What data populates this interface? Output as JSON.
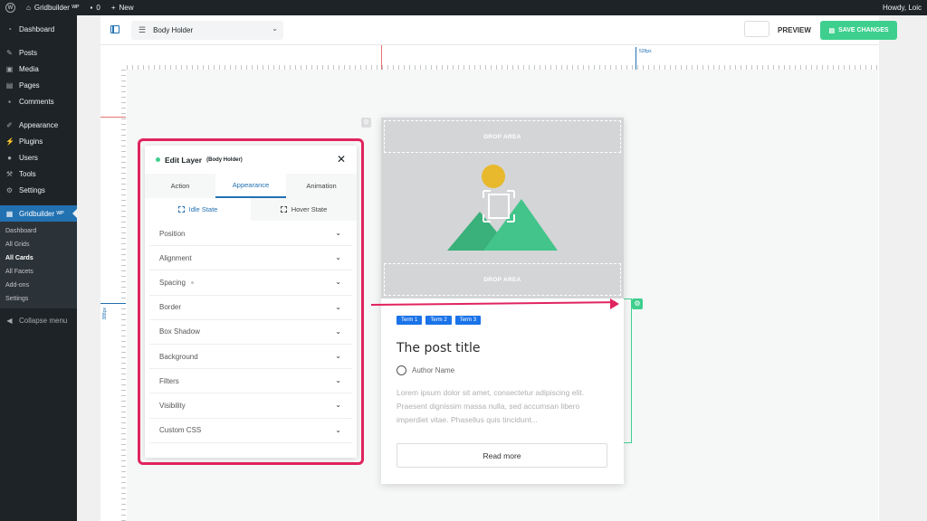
{
  "admin_bar": {
    "site_name": "Gridbuilder ᵂᴾ",
    "comments_count": "0",
    "new_label": "New",
    "howdy": "Howdy, Loic"
  },
  "sidebar": {
    "items": [
      {
        "label": "Dashboard",
        "icon": "dashboard-icon"
      },
      {
        "label": "Posts",
        "icon": "pin-icon"
      },
      {
        "label": "Media",
        "icon": "media-icon"
      },
      {
        "label": "Pages",
        "icon": "page-icon"
      },
      {
        "label": "Comments",
        "icon": "comment-icon"
      },
      {
        "label": "Appearance",
        "icon": "brush-icon"
      },
      {
        "label": "Plugins",
        "icon": "plugin-icon"
      },
      {
        "label": "Users",
        "icon": "user-icon"
      },
      {
        "label": "Tools",
        "icon": "wrench-icon"
      },
      {
        "label": "Settings",
        "icon": "settings-icon"
      }
    ],
    "active": {
      "label": "Gridbuilder ᵂᴾ",
      "icon": "gridbuilder-icon"
    },
    "submenu": [
      "Dashboard",
      "All Grids",
      "All Cards",
      "All Facets",
      "Add-ons",
      "Settings"
    ],
    "submenu_current": "All Cards",
    "collapse": "Collapse menu"
  },
  "toolbar": {
    "layer_select": "Body Holder",
    "preview_label": "PREVIEW",
    "save_label": "SAVE CHANGES"
  },
  "rulers": {
    "top_px": "528px",
    "left_px": "388px"
  },
  "card": {
    "drop_area_top": "DROP AREA",
    "drop_area_bottom": "DROP AREA",
    "terms": [
      "Term 1",
      "Term 2",
      "Term 3"
    ],
    "title": "The post title",
    "author": "Author Name",
    "excerpt": "Lorem ipsum dolor sit amet, consectetur adipiscing elit. Praesent dignissim massa nulla, sed accumsan libero imperdiet vitae. Phasellus quis tincidunt...",
    "read_more": "Read more"
  },
  "edit_panel": {
    "title": "Edit Layer",
    "subtitle": "(Body Holder)",
    "tabs": [
      "Action",
      "Appearance",
      "Animation"
    ],
    "active_tab": "Appearance",
    "state_tabs": [
      "Idle State",
      "Hover State"
    ],
    "active_state": "Idle State",
    "sections": [
      "Position",
      "Alignment",
      "Spacing",
      "Border",
      "Box Shadow",
      "Background",
      "Filters",
      "Visibility",
      "Custom CSS"
    ]
  },
  "colors": {
    "accent": "#2271b1",
    "save_green": "#3ecf8e",
    "highlight": "#e0245e",
    "term_blue": "#1a73e8"
  }
}
